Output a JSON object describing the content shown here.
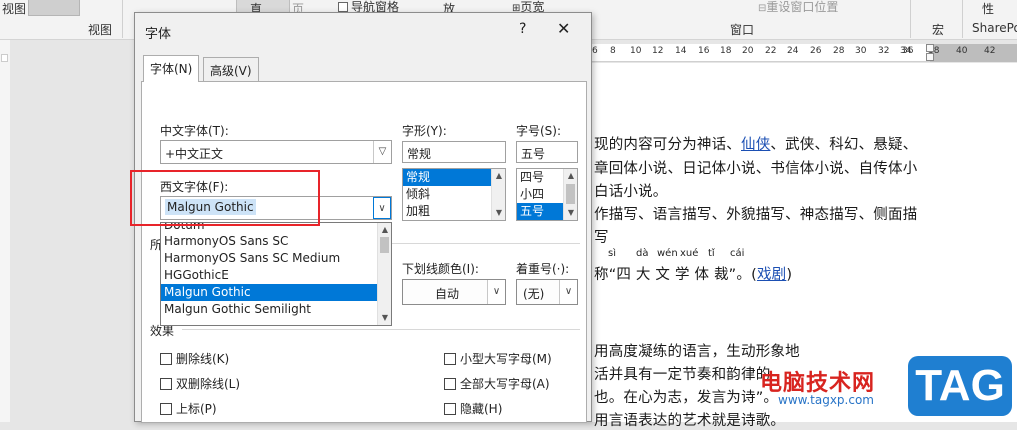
{
  "ribbon": {
    "view_label_top": "视图",
    "view_group": "视图",
    "btn_active": "直",
    "btn_page": "页",
    "nav_pane": "导航窗格",
    "zoom_btn": "放",
    "page_width": "页宽",
    "reset_window": "重设窗口位置",
    "window_group": "窗口",
    "macro_group": "宏",
    "property": "性",
    "sharepoint": "SharePo"
  },
  "ruler": {
    "numbers": [
      "6",
      "8",
      "10",
      "12",
      "14",
      "16",
      "18",
      "20",
      "22",
      "24",
      "26",
      "28",
      "30",
      "32",
      "34",
      "36",
      "38",
      "40",
      "42"
    ]
  },
  "document": {
    "line1_pre": "现的内容可分为神话、",
    "line1_link": "仙侠",
    "line1_post": "、武侠、科幻、悬疑、",
    "line2": "章回体小说、日记体小说、书信体小说、自传体小",
    "line3": "白话小说。",
    "line4": "作描写、语言描写、外貌描写、神态描写、侧面描",
    "line5": "写",
    "ruby": [
      "sì",
      "dà",
      "wén",
      "xué",
      "tǐ",
      "cái"
    ],
    "line6_pre": "称“四 大 文 学 体 裁”。(",
    "line6_link": "戏剧",
    "line6_post": ")",
    "line7": "用高度凝练的语言，生动形象地",
    "line8": "活并具有一定节奏和韵律的",
    "line9": "也。在心为志，发言为诗”。",
    "line10": "用言语表达的艺术就是诗歌。",
    "watermark_text": "电脑技术网",
    "watermark_url": "www.tagxp.com",
    "watermark_tag": "TAG"
  },
  "dialog": {
    "title": "字体",
    "help": "?",
    "close": "✕",
    "tab_font": "字体(N)",
    "tab_advanced": "高级(V)",
    "cn_font_label": "中文字体(T):",
    "cn_font_value": "+中文正文",
    "style_label": "字形(Y):",
    "style_value": "常规",
    "style_options": [
      "常规",
      "倾斜",
      "加粗"
    ],
    "size_label": "字号(S):",
    "size_value": "五号",
    "size_options": [
      "四号",
      "小四",
      "五号"
    ],
    "west_font_label": "西文字体(F):",
    "west_font_value": "Malgun Gothic",
    "font_dropdown": [
      "Dotum",
      "HarmonyOS Sans SC",
      "HarmonyOS Sans SC Medium",
      "HGGothicE",
      "Malgun Gothic",
      "Malgun Gothic Semilight"
    ],
    "all_text_label": "所",
    "underline_color_label": "下划线颜色(I):",
    "underline_color_value": "自动",
    "emphasis_label": "着重号(·):",
    "emphasis_value": "(无)",
    "effects_label": "效果",
    "effects": {
      "strikethrough": "删除线(K)",
      "double_strike": "双删除线(L)",
      "superscript": "上标(P)",
      "small_caps": "小型大写字母(M)",
      "all_caps": "全部大写字母(A)",
      "hidden": "隐藏(H)"
    }
  }
}
